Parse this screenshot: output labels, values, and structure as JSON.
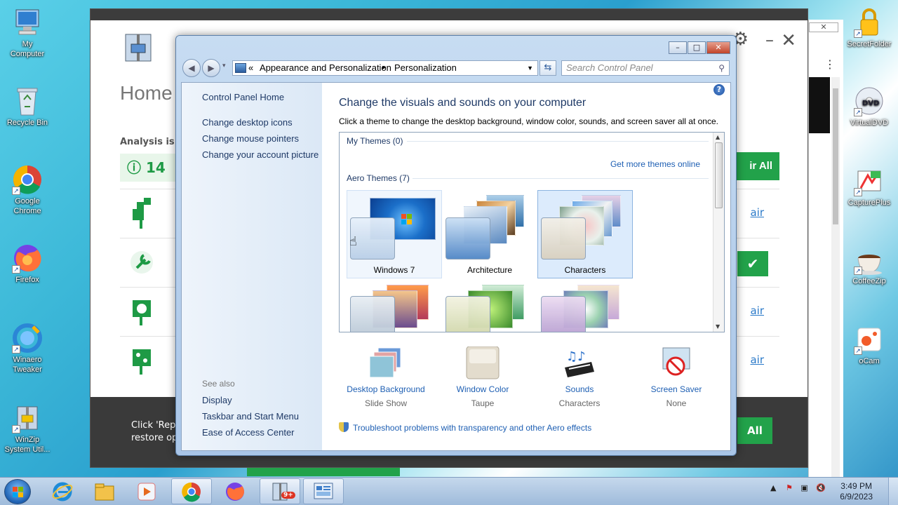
{
  "desktop": {
    "left_icons": [
      {
        "label": "My\nComputer",
        "line1": "My",
        "line2": "Computer"
      },
      {
        "line1": "Recycle Bin",
        "line2": ""
      },
      {
        "line1": "Google",
        "line2": "Chrome"
      },
      {
        "line1": "Firefox",
        "line2": ""
      },
      {
        "line1": "Winaero",
        "line2": "Tweaker"
      },
      {
        "line1": "WinZip",
        "line2": "System Util..."
      }
    ],
    "right_icons": [
      {
        "line1": "SecretFolder"
      },
      {
        "line1": "VirtualDVD"
      },
      {
        "line1": "CapturePlus"
      },
      {
        "line1": "CoffeeZip"
      },
      {
        "line1": "oCam"
      }
    ]
  },
  "winzip_bg": {
    "home_title": "Home",
    "analysis_text": "Analysis is co",
    "issues_count": "14",
    "repair_all_label": "ir All",
    "repair_link": "air",
    "footer_line1": "Click 'Repa",
    "footer_line2": "restore op",
    "footer_all_label": "All"
  },
  "browser_frag": {
    "close_label": "✕",
    "menu_label": "⋮"
  },
  "window": {
    "caption_buttons": {
      "minimize": "–",
      "maximize": "□",
      "close": "✕"
    },
    "address": {
      "chevrons": "«",
      "segment1": "Appearance and Personalization",
      "separator": "▸",
      "segment2": "Personalization"
    },
    "search_placeholder": "Search Control Panel",
    "left_pane": {
      "home": "Control Panel Home",
      "links": [
        "Change desktop icons",
        "Change mouse pointers",
        "Change your account picture"
      ],
      "see_also": "See also",
      "see_also_links": [
        "Display",
        "Taskbar and Start Menu",
        "Ease of Access Center"
      ]
    },
    "main": {
      "title": "Change the visuals and sounds on your computer",
      "subtitle": "Click a theme to change the desktop background, window color, sounds, and screen saver all at once.",
      "my_themes": "My Themes (0)",
      "get_more": "Get more themes online",
      "aero_themes": "Aero Themes (7)",
      "themes": [
        "Windows 7",
        "Architecture",
        "Characters"
      ],
      "bottom": [
        {
          "label": "Desktop Background",
          "value": "Slide Show"
        },
        {
          "label": "Window Color",
          "value": "Taupe"
        },
        {
          "label": "Sounds",
          "value": "Characters"
        },
        {
          "label": "Screen Saver",
          "value": "None"
        }
      ],
      "troubleshoot": "Troubleshoot problems with transparency and other Aero effects"
    }
  },
  "taskbar": {
    "badge": "9+",
    "time": "3:49 PM",
    "date": "6/9/2023"
  }
}
